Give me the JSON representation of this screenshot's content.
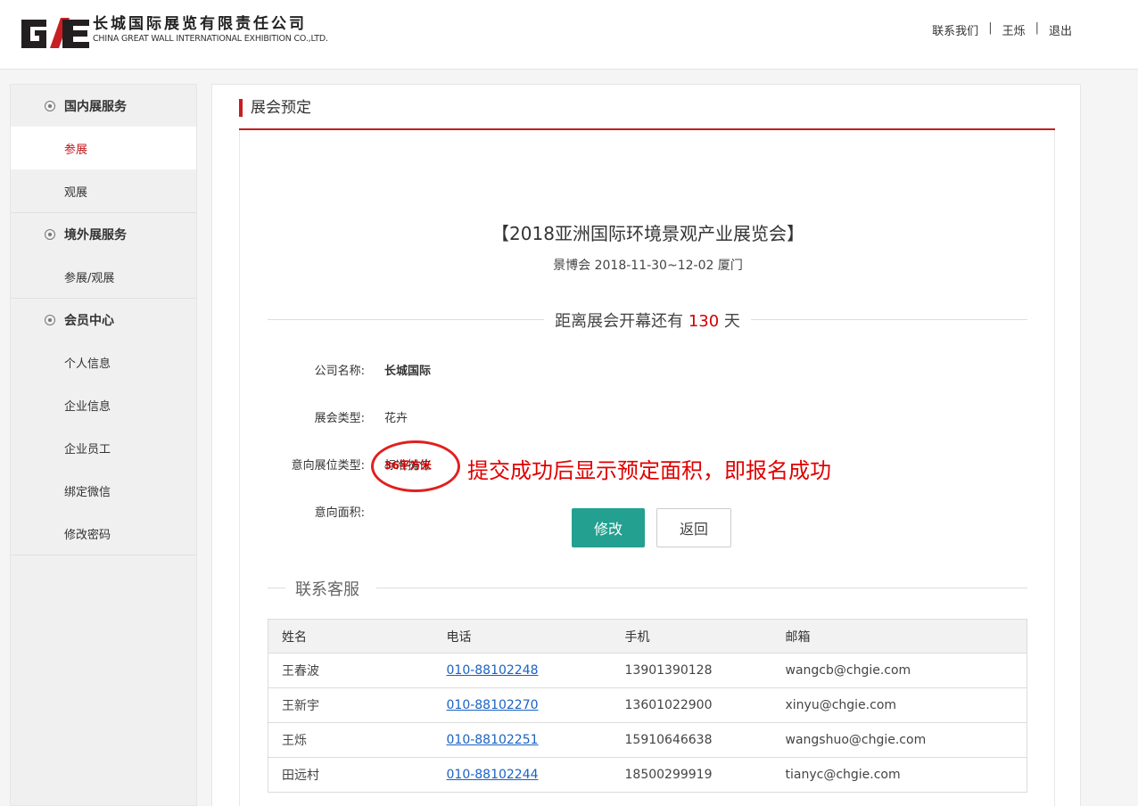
{
  "brand": {
    "mark_letters": "GE",
    "name_cn": "长城国际展览有限责任公司",
    "name_en": "CHINA GREAT WALL INTERNATIONAL EXHIBITION CO.,LTD."
  },
  "topnav": {
    "contact": "联系我们",
    "user": "王烁",
    "logout": "退出",
    "separator": "|"
  },
  "sidebar": {
    "groups": [
      {
        "title": "国内展服务",
        "items": [
          "参展",
          "观展"
        ]
      },
      {
        "title": "境外展服务",
        "items": [
          "参展/观展"
        ]
      },
      {
        "title": "会员中心",
        "items": [
          "个人信息",
          "企业信息",
          "企业员工",
          "绑定微信",
          "修改密码"
        ]
      }
    ],
    "active_item": "参展"
  },
  "panel": {
    "title": "展会预定"
  },
  "expo": {
    "title": "【2018亚洲国际环境景观产业展览会】",
    "subtitle": "景博会 2018-11-30~12-02 厦门",
    "countdown_prefix": "距离展会开幕还有",
    "countdown_days": "130",
    "countdown_suffix": "天"
  },
  "form": {
    "company_label": "公司名称:",
    "company_value": "长城国际",
    "type_label": "展会类型:",
    "type_value": "花卉",
    "booth_label": "意向展位类型:",
    "booth_value": "标准摊位",
    "area_label": "意向面积:",
    "area_value": "36平方米"
  },
  "annotation": "提交成功后显示预定面积，即报名成功",
  "buttons": {
    "edit": "修改",
    "back": "返回"
  },
  "customer_service": {
    "heading": "联系客服",
    "columns": [
      "姓名",
      "电话",
      "手机",
      "邮箱"
    ],
    "rows": [
      {
        "name": "王春波",
        "phone": "010-88102248",
        "mobile": "13901390128",
        "email": "wangcb@chgie.com"
      },
      {
        "name": "王新宇",
        "phone": "010-88102270",
        "mobile": "13601022900",
        "email": "xinyu@chgie.com"
      },
      {
        "name": "王烁",
        "phone": "010-88102251",
        "mobile": "15910646638",
        "email": "wangshuo@chgie.com"
      },
      {
        "name": "田远村",
        "phone": "010-88102244",
        "mobile": "18500299919",
        "email": "tianyc@chgie.com"
      }
    ]
  },
  "colors": {
    "accent_red": "#c81d22",
    "teal_button": "#23a08f",
    "annotation_red": "#e00000",
    "link_blue": "#1a62c4"
  }
}
